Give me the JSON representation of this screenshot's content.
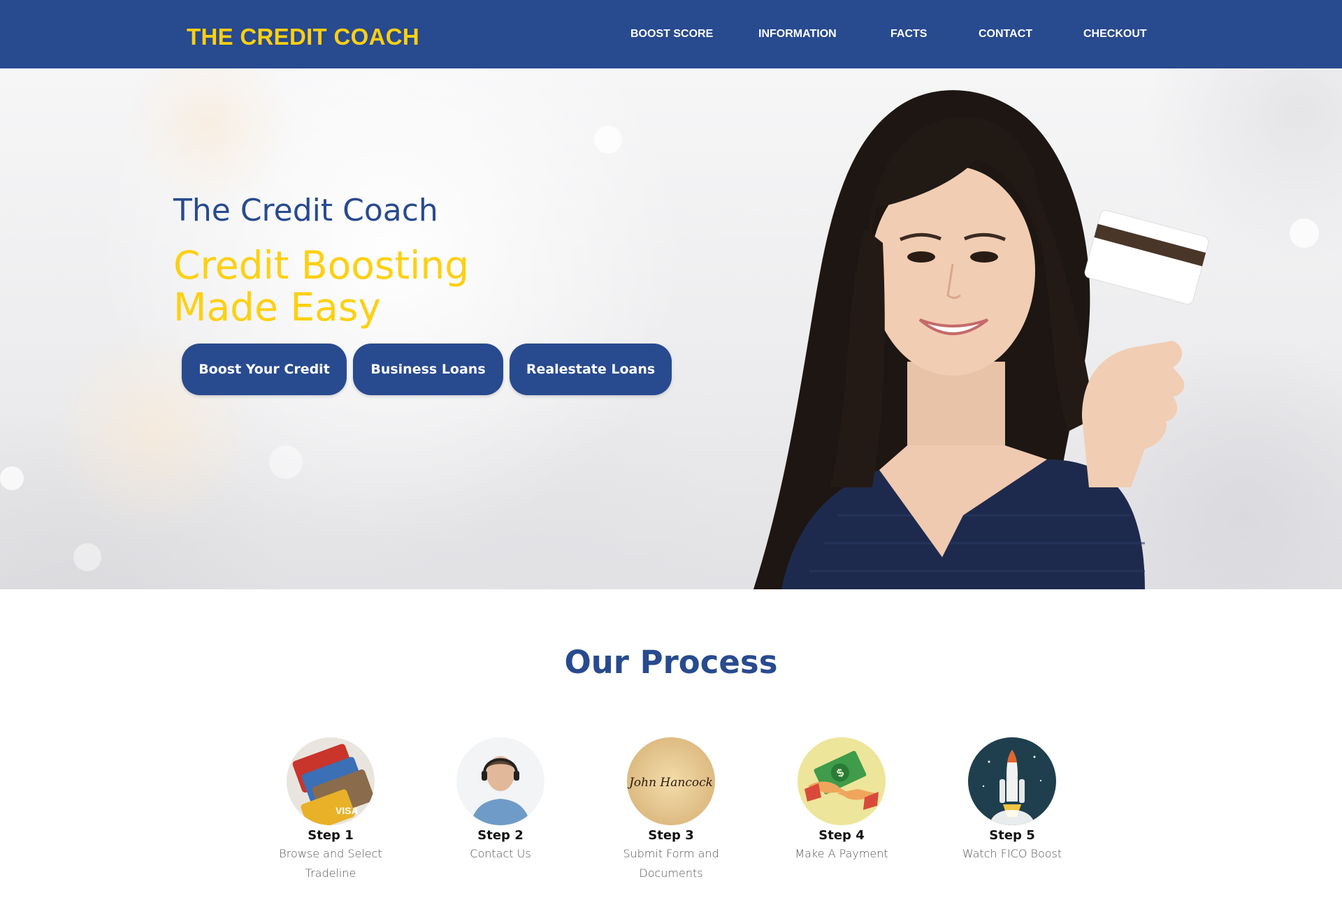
{
  "header": {
    "brand": "THE CREDIT COACH",
    "nav": [
      "BOOST SCORE",
      "INFORMATION",
      "FACTS",
      "CONTACT",
      "CHECKOUT"
    ]
  },
  "hero": {
    "title": "The Credit Coach",
    "tagline_line1": "Credit Boosting",
    "tagline_line2": "Made Easy",
    "buttons": [
      "Boost Your Credit",
      "Business Loans",
      "Realestate Loans"
    ]
  },
  "process": {
    "title": "Our Process",
    "steps": [
      {
        "label": "Step 1",
        "line1": "Browse and Select",
        "line2": "Tradeline",
        "icon": "credit-cards-icon"
      },
      {
        "label": "Step 2",
        "line1": "Contact Us",
        "line2": "",
        "icon": "support-agent-icon"
      },
      {
        "label": "Step 3",
        "line1": "Submit Form and",
        "line2": "Documents",
        "icon": "signature-icon",
        "signature": "John Hancock"
      },
      {
        "label": "Step 4",
        "line1": "Make A Payment",
        "line2": "",
        "icon": "payment-hands-icon"
      },
      {
        "label": "Step 5",
        "line1": "Watch FICO Boost",
        "line2": "",
        "icon": "rocket-launch-icon"
      }
    ]
  },
  "colors": {
    "primary_blue": "#284a8f",
    "accent_yellow": "#fdd012",
    "white": "#ffffff"
  }
}
